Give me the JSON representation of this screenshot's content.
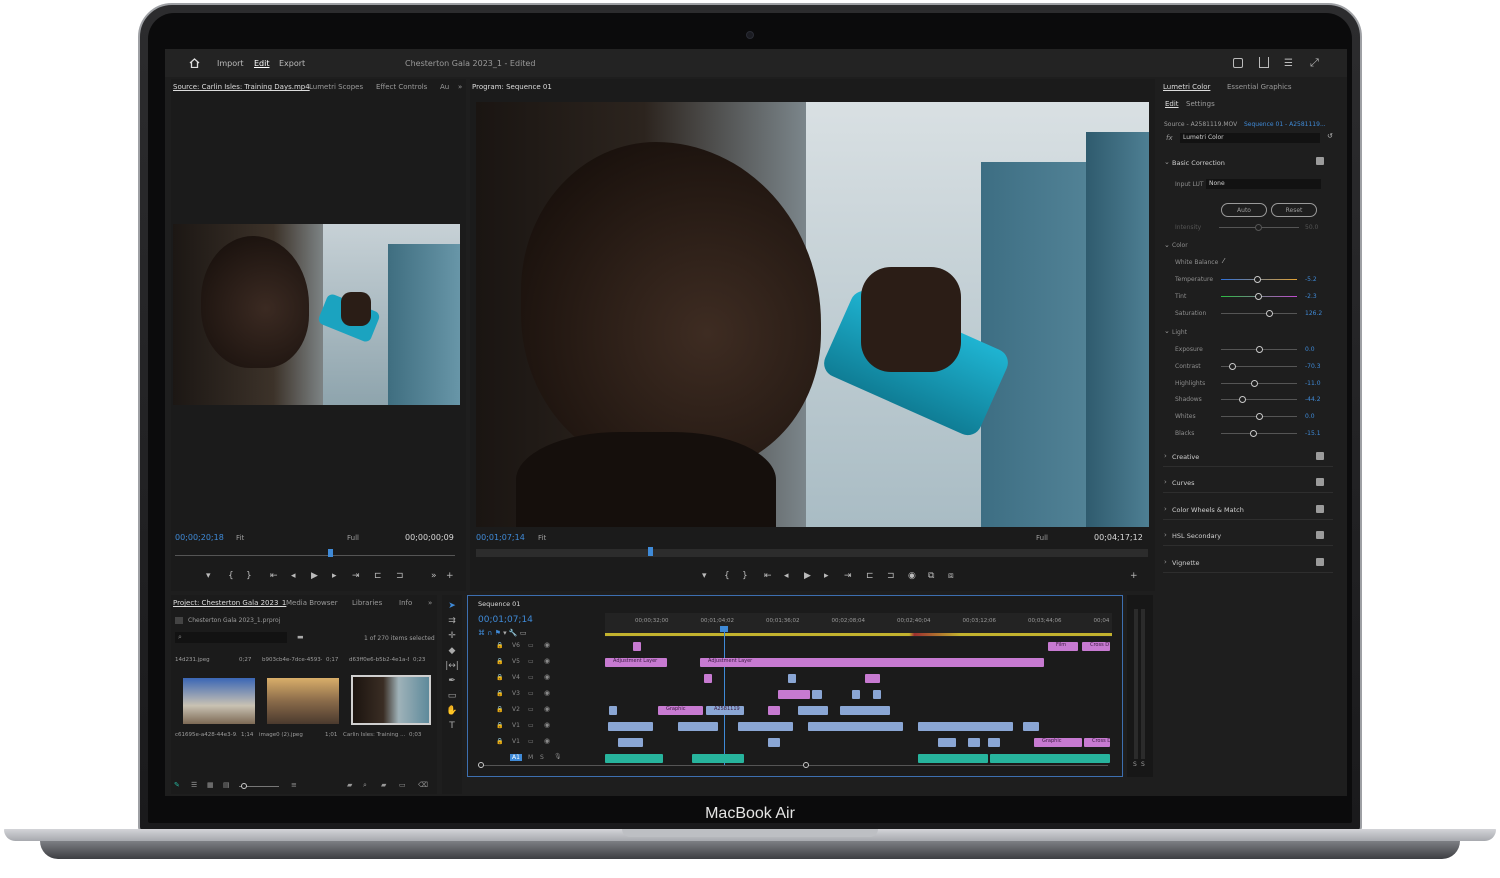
{
  "device": {
    "brand": "MacBook Air"
  },
  "titlebar": {
    "menu": [
      "Import",
      "Edit",
      "Export"
    ],
    "active_menu": "Edit",
    "doc_title": "Chesterton Gala 2023_1 - Edited"
  },
  "source_monitor": {
    "tabs": [
      "Source: Carlin Isles: Training Days.mp4",
      "Lumetri Scopes",
      "Effect Controls",
      "Au"
    ],
    "timecode": "00;00;20;18",
    "fit": "Fit",
    "quality": "Full",
    "duration": "00;00;00;09"
  },
  "program_monitor": {
    "tab": "Program: Sequence 01",
    "timecode": "00;01;07;14",
    "fit": "Fit",
    "quality": "Full",
    "duration": "00;04;17;12"
  },
  "project": {
    "tabs": [
      "Project: Chesterton Gala 2023_1",
      "Media Browser",
      "Libraries",
      "Info"
    ],
    "file": "Chesterton Gala 2023_1.prproj",
    "selection": "1 of 270 items selected",
    "bins_top": [
      {
        "name": "14d231.jpeg",
        "dur": "0;27"
      },
      {
        "name": "b903cb4e-7dce-4593-8...",
        "dur": "0;17"
      },
      {
        "name": "d63ff0e6-b5b2-4e1a-8c...",
        "dur": "0;23"
      }
    ],
    "items": [
      {
        "name": "c61695e-a428-44e3-9...",
        "dur": "1;14"
      },
      {
        "name": "image0 (2).jpeg",
        "dur": "1;01"
      },
      {
        "name": "Carlin Isles: Training ...",
        "dur": "0;03"
      }
    ]
  },
  "timeline": {
    "tab": "Sequence 01",
    "timecode": "00;01;07;14",
    "ruler": [
      "00;00;32;00",
      "00;01;04;02",
      "00;01;36;02",
      "00;02;08;04",
      "00;02;40;04",
      "00;03;12;06",
      "00;03;44;06",
      "00;04"
    ],
    "tracks": [
      "V6",
      "V5",
      "V4",
      "V3",
      "V2",
      "V1",
      "V1"
    ],
    "audio_track": "A1",
    "clip_labels": {
      "adj1": "Adjustment Layer",
      "adj2": "Adjustment Layer",
      "film": "Film",
      "cross": "Cross D",
      "graphic1": "Graphic",
      "a258": "A2581119",
      "graphic2": "Graphic",
      "cross2": "Cross D"
    }
  },
  "lumetri": {
    "tabs": [
      "Lumetri Color",
      "Essential Graphics"
    ],
    "sub_tabs": [
      "Edit",
      "Settings"
    ],
    "source": "Source - A2581119.MOV",
    "sequence": "Sequence 01 - A2581119...",
    "fx": "Lumetri Color",
    "basic": "Basic Correction",
    "input_lut_label": "Input LUT",
    "input_lut": "None",
    "auto": "Auto",
    "reset": "Reset",
    "intensity_label": "Intensity",
    "intensity": "50.0",
    "color_section": "Color",
    "white_balance": "White Balance",
    "sliders": [
      {
        "label": "Temperature",
        "value": "-5.2",
        "level": 0.47
      },
      {
        "label": "Tint",
        "value": "-2.3",
        "level": 0.49
      },
      {
        "label": "Saturation",
        "value": "126.2",
        "level": 0.63
      }
    ],
    "light_section": "Light",
    "light": [
      {
        "label": "Exposure",
        "value": "0.0",
        "level": 0.5
      },
      {
        "label": "Contrast",
        "value": "-70.3",
        "level": 0.15
      },
      {
        "label": "Highlights",
        "value": "-11.0",
        "level": 0.44
      },
      {
        "label": "Shadows",
        "value": "-44.2",
        "level": 0.28
      },
      {
        "label": "Whites",
        "value": "0.0",
        "level": 0.5
      },
      {
        "label": "Blacks",
        "value": "-15.1",
        "level": 0.42
      }
    ],
    "sections": [
      "Creative",
      "Curves",
      "Color Wheels & Match",
      "HSL Secondary",
      "Vignette"
    ]
  },
  "colors": {
    "accent": "#3f8ad7",
    "clip_pink": "#c77ad1",
    "clip_blue": "#8aa6d4",
    "clip_teal": "#27b49d"
  }
}
